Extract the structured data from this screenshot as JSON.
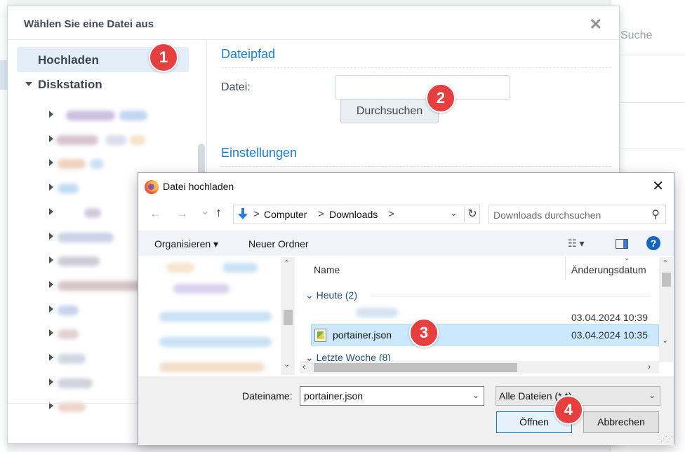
{
  "background": {
    "search_placeholder": "Suche"
  },
  "synology_dialog": {
    "title": "Wählen Sie eine Datei aus",
    "close_glyph": "✕",
    "nav": {
      "upload_label": "Hochladen",
      "diskstation_label": "Diskstation",
      "tree_rows": 12
    },
    "section_path": "Dateipfad",
    "file_label": "Datei:",
    "file_value": "",
    "browse_label": "Durchsuchen",
    "section_settings": "Einstellungen"
  },
  "file_dialog": {
    "title": "Datei hochladen",
    "close_glyph": "✕",
    "nav": {
      "back_glyph": "←",
      "forward_glyph": "→",
      "recent_glyph": "⌄",
      "up_glyph": "↑",
      "breadcrumb": [
        "Computer",
        "Downloads"
      ],
      "breadcrumb_sep": ">",
      "refresh_glyph": "↻",
      "search_placeholder": "Downloads durchsuchen"
    },
    "toolbar": {
      "organize_label": "Organisieren ▾",
      "new_folder_label": "Neuer Ordner",
      "view_glyph": "☷ ▾",
      "help_glyph": "?"
    },
    "columns": {
      "name": "Name",
      "modified": "Änderungsdatum"
    },
    "groups": [
      {
        "label": "Heute (2)"
      },
      {
        "label": "Letzte Woche (8)"
      }
    ],
    "rows": [
      {
        "name": "",
        "modified": "03.04.2024 10:39",
        "selected": false
      },
      {
        "name": "portainer.json",
        "modified": "03.04.2024 10:35",
        "selected": true
      }
    ],
    "footer": {
      "filename_label": "Dateiname:",
      "filename_value": "portainer.json",
      "filetype_value": "Alle Dateien (*.*)",
      "open_label": "Öffnen",
      "cancel_label": "Abbrechen"
    }
  },
  "badges": [
    "1",
    "2",
    "3",
    "4"
  ],
  "colors": {
    "synology_accent": "#1a7fd4",
    "badge_red": "#e53f3f",
    "selection_blue": "#cce8ff",
    "windows_help_blue": "#1565c0"
  }
}
